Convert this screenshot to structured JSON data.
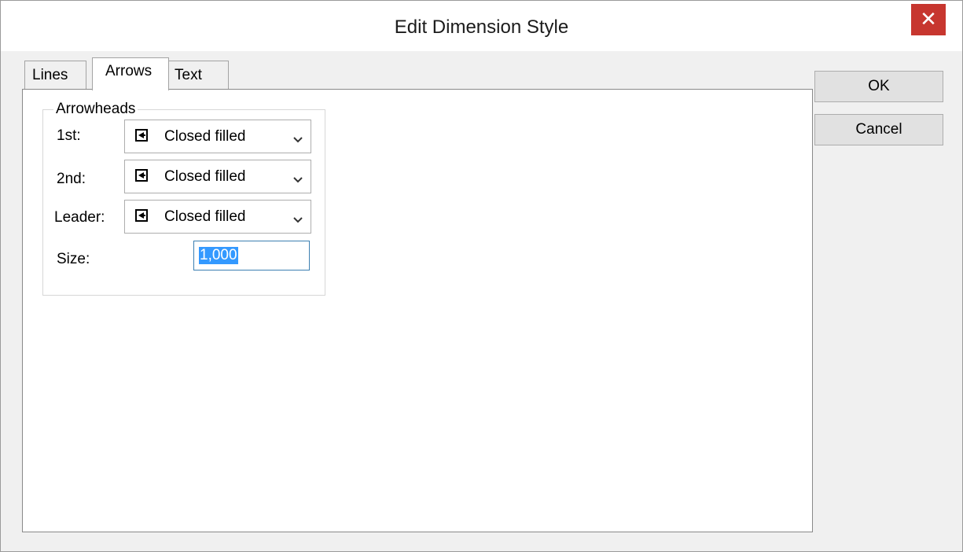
{
  "window": {
    "title": "Edit Dimension Style",
    "close_glyph": "✕"
  },
  "tabs": [
    {
      "label": "Lines"
    },
    {
      "label": "Arrows",
      "active": true
    },
    {
      "label": "Text"
    }
  ],
  "arrowheads": {
    "legend": "Arrowheads",
    "first": {
      "label": "1st:",
      "value": "Closed filled",
      "icon": "closed-filled-arrow-icon"
    },
    "second": {
      "label": "2nd:",
      "value": "Closed filled",
      "icon": "closed-filled-arrow-icon"
    },
    "leader": {
      "label": "Leader:",
      "value": "Closed filled",
      "icon": "closed-filled-arrow-icon"
    },
    "size": {
      "label": "Size:",
      "value": "1,000"
    }
  },
  "buttons": {
    "ok": "OK",
    "cancel": "Cancel"
  },
  "colors": {
    "close_button": "#c7362f",
    "selection": "#3399ff",
    "input_focus_border": "#3c7fb1"
  }
}
